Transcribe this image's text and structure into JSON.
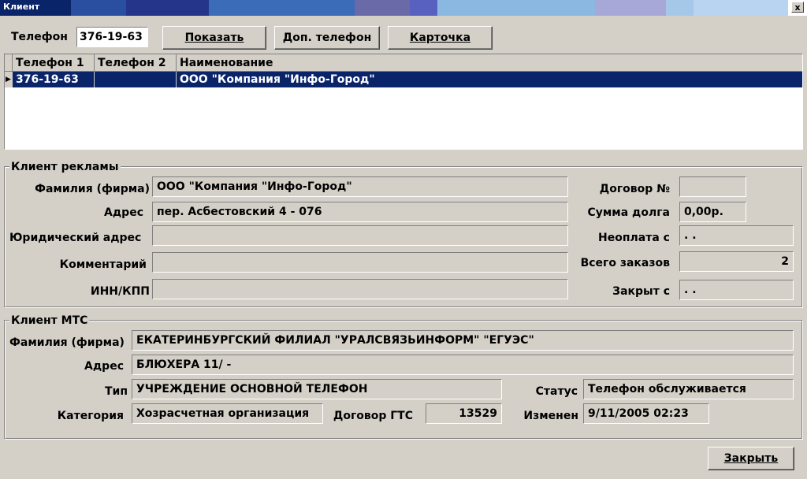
{
  "window": {
    "title": "Клиент",
    "close": "x"
  },
  "search": {
    "label": "Телефон",
    "value": "376-19-63"
  },
  "buttons": {
    "show": "Показать",
    "extra_phone": "Доп. телефон",
    "card": "Карточка",
    "close": "Закрыть"
  },
  "grid": {
    "columns": [
      "Телефон 1",
      "Телефон 2",
      "Наименование"
    ],
    "rows": [
      {
        "phone1": "376-19-63",
        "phone2": "",
        "name": "ООО \"Компания \"Инфо-Город\""
      }
    ]
  },
  "ad_client": {
    "title": "Клиент рекламы",
    "surname_label": "Фамилия (фирма)",
    "surname": "ООО \"Компания \"Инфо-Город\"",
    "address_label": "Адрес",
    "address": "пер. Асбестовский 4 - 076",
    "legal_address_label": "Юридический адрес",
    "legal_address": "",
    "comment_label": "Комментарий",
    "comment": "",
    "inn_label": "ИНН/КПП",
    "inn": "",
    "contract_label": "Договор №",
    "contract": "",
    "debt_label": "Сумма долга",
    "debt": "0,00р.",
    "unpaid_label": "Неоплата с",
    "unpaid": ". .",
    "orders_label": "Всего заказов",
    "orders": "2",
    "closed_label": "Закрыт с",
    "closed": ". ."
  },
  "mts_client": {
    "title": "Клиент МТС",
    "surname_label": "Фамилия (фирма)",
    "surname": "ЕКАТЕРИНБУРГСКИЙ ФИЛИАЛ \"УРАЛСВЯЗЬИНФОРМ\" \"ЕГУЭС\"",
    "address_label": "Адрес",
    "address": "БЛЮХЕРА 11/ -",
    "type_label": "Тип",
    "type": "УЧРЕЖДЕНИЕ ОСНОВНОЙ ТЕЛЕФОН",
    "status_label": "Статус",
    "status": "Телефон обслуживается",
    "category_label": "Категория",
    "category": "Хозрасчетная организация",
    "gts_label": "Договор ГТС",
    "gts": "13529",
    "changed_label": "Изменен",
    "changed": "9/11/2005 02:23"
  }
}
